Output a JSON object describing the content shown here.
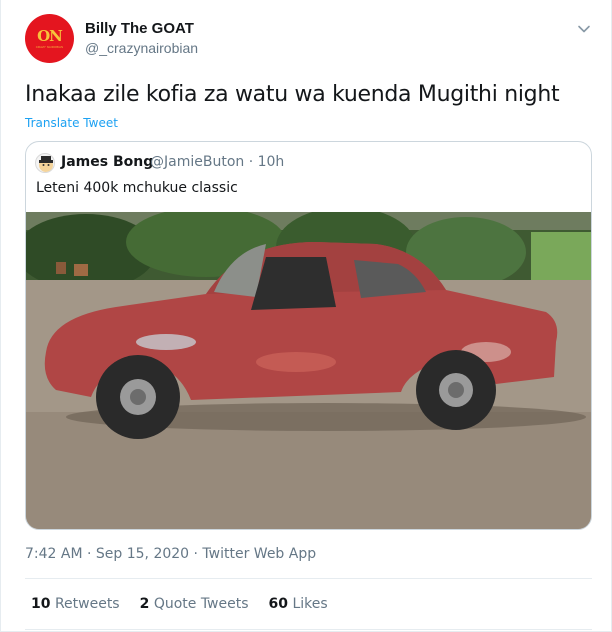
{
  "author": {
    "name": "Billy The GOAT",
    "handle": "@_crazynairobian",
    "avatar_text": "ON",
    "avatar_subtext": "CRAZY NAIROBIAN",
    "avatar_color": "#e4151f",
    "avatar_text_color": "#f7c23b"
  },
  "tweet": {
    "text": "Inakaa zile kofia za watu wa kuenda Mugithi night",
    "translate_label": "Translate Tweet",
    "timestamp": "7:42 AM · Sep 15, 2020 · Twitter Web App",
    "menu_icon": "chevron-down-icon"
  },
  "quoted": {
    "name": "James Bong",
    "handle_time": "@JamieButon · 10h",
    "text": "Leteni 400k mchukue classic",
    "image": "photo of a rusty red vintage car parked on gravel in front of hedges"
  },
  "stats": {
    "retweets_count": "10",
    "retweets_label": "Retweets",
    "quotes_count": "2",
    "quotes_label": "Quote Tweets",
    "likes_count": "60",
    "likes_label": "Likes"
  },
  "colors": {
    "link": "#1da1f2",
    "secondary_text": "#657786",
    "border": "#e6ecf0"
  }
}
